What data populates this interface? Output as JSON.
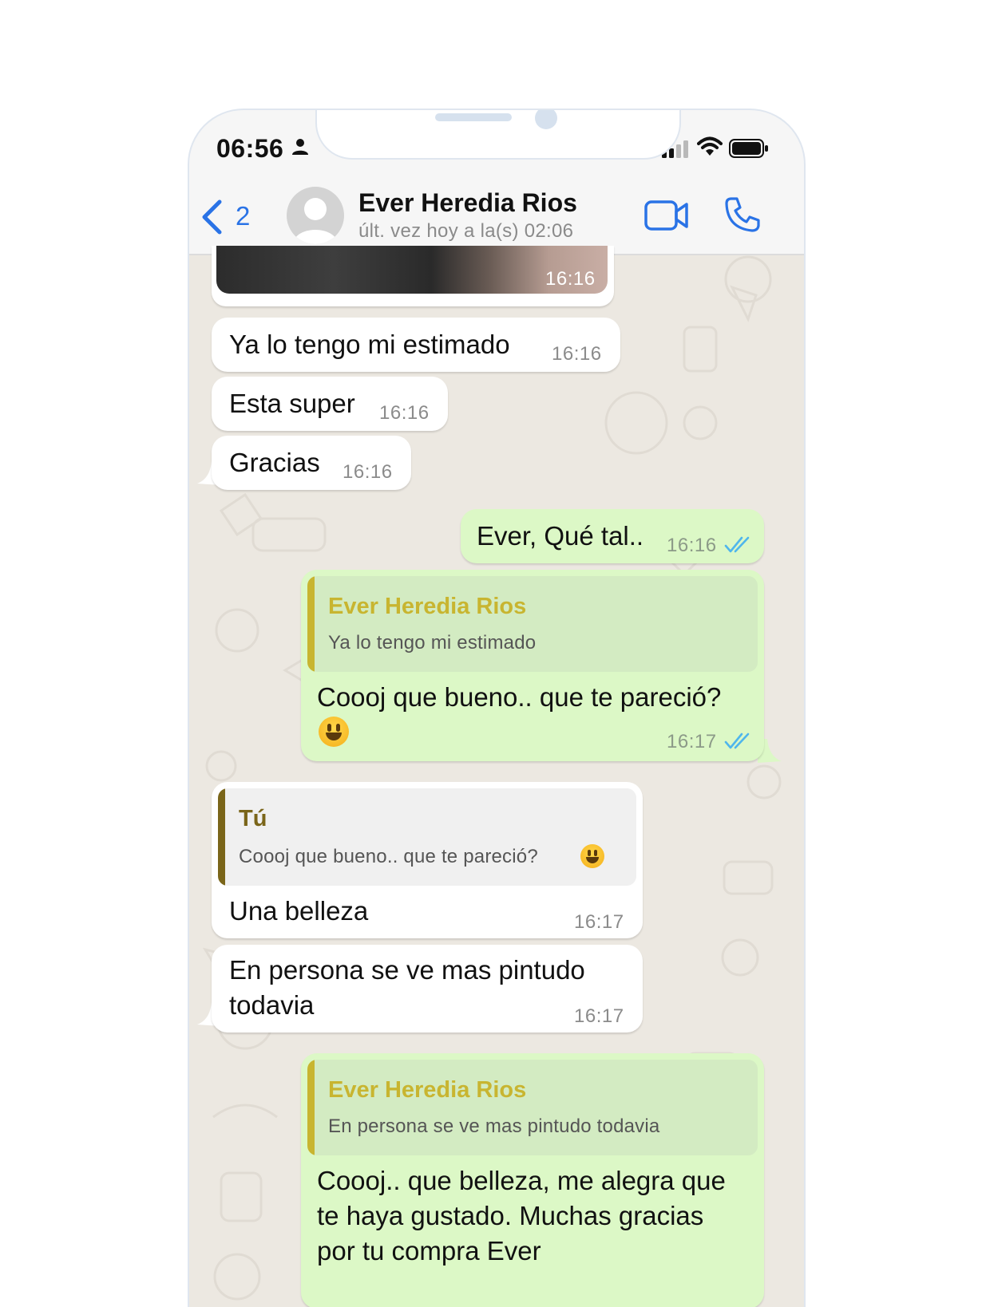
{
  "status_bar": {
    "time": "06:56"
  },
  "header": {
    "unread_count": "2",
    "contact_name": "Ever Heredia Rios",
    "last_seen": "últ. vez hoy a la(s) 02:06"
  },
  "messages": [
    {
      "type": "image",
      "direction": "in",
      "time": "16:16"
    },
    {
      "direction": "in",
      "text": "Ya lo tengo mi estimado",
      "time": "16:16"
    },
    {
      "direction": "in",
      "text": "Esta super",
      "time": "16:16"
    },
    {
      "direction": "in",
      "text": "Gracias",
      "time": "16:16"
    },
    {
      "direction": "out",
      "text": "Ever, Qué tal..",
      "time": "16:16",
      "status": "read"
    },
    {
      "direction": "out",
      "quote": {
        "author": "Ever Heredia Rios",
        "text": "Ya lo tengo mi estimado"
      },
      "text": "Coooj que bueno.. que te pareció?",
      "emoji": "grinning-face",
      "time": "16:17",
      "status": "read"
    },
    {
      "direction": "in",
      "quote": {
        "author": "Tú",
        "text": "Coooj que bueno.. que te pareció?"
      },
      "text": "Una belleza",
      "time": "16:17"
    },
    {
      "direction": "in",
      "text_lines": [
        "En persona se ve mas pintudo",
        "todavia"
      ],
      "time": "16:17"
    },
    {
      "direction": "out",
      "quote": {
        "author": "Ever Heredia Rios",
        "text": "En persona se ve mas pintudo todavia"
      },
      "text_lines": [
        "Coooj.. que belleza, me alegra que",
        "te haya gustado. Muchas gracias",
        "por tu compra Ever"
      ]
    }
  ],
  "colors": {
    "accent": "#2a73e6",
    "incoming_bubble": "#ffffff",
    "outgoing_bubble": "#dcf8c6",
    "read_ticks": "#4fb6ec",
    "quote_author_contact": "#c8b530",
    "quote_author_self": "#7a6519",
    "chat_background": "#ece8e1"
  }
}
